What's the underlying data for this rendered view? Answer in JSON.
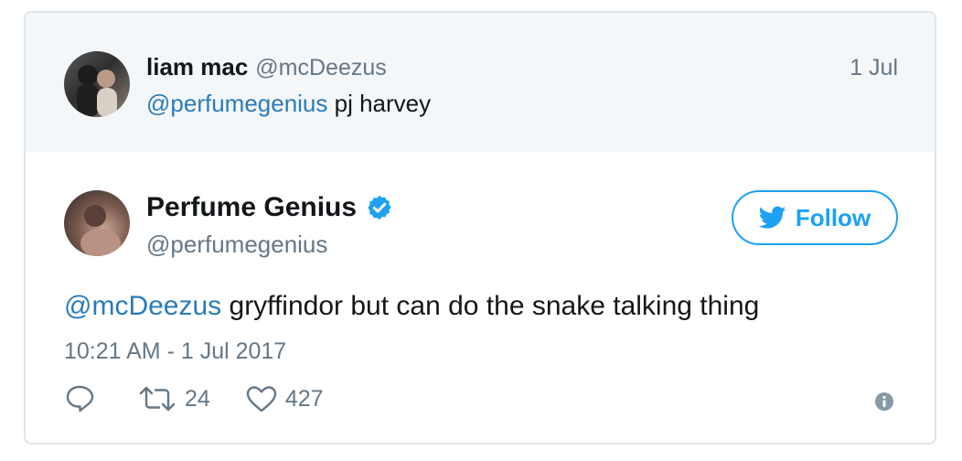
{
  "parent_tweet": {
    "author_name": "liam mac",
    "author_handle": "@mcDeezus",
    "date": "1 Jul",
    "mention": "@perfumegenius",
    "text": " pj harvey"
  },
  "main_tweet": {
    "author_name": "Perfume Genius",
    "verified_icon": "verified-badge-icon",
    "author_handle": "@perfumegenius",
    "follow_label": "Follow",
    "mention": "@mcDeezus",
    "text": " gryffindor but can do the snake talking thing",
    "timestamp": "10:21 AM - 1 Jul 2017",
    "actions": {
      "reply_count": "",
      "retweet_count": "24",
      "like_count": "427"
    }
  },
  "colors": {
    "link": "#2b7bb9",
    "twitter_blue": "#1da1f2",
    "muted": "#657786",
    "text": "#14171a",
    "parent_bg": "#f4f7f9",
    "border": "#dfe5ea"
  }
}
